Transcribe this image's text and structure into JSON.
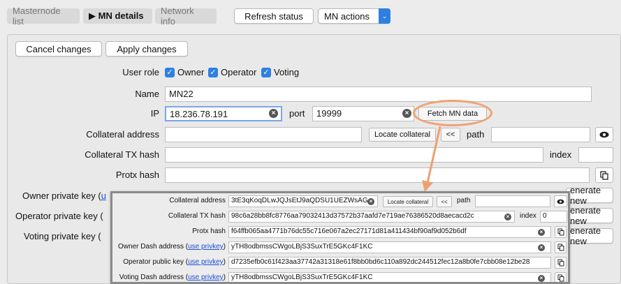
{
  "tabs": {
    "masternode_list": "Masternode list",
    "mn_details": "▶ MN details",
    "network_info": "Network info"
  },
  "toolbar": {
    "refresh_label": "Refresh status",
    "mn_actions_label": "MN actions"
  },
  "actions": {
    "cancel_label": "Cancel changes",
    "apply_label": "Apply changes"
  },
  "form": {
    "user_role_label": "User role",
    "roles": {
      "owner": "Owner",
      "operator": "Operator",
      "voting": "Voting"
    },
    "name_label": "Name",
    "name_value": "MN22",
    "ip_label": "IP",
    "ip_value": "18.236.78.191",
    "port_label": "port",
    "port_value": "19999",
    "fetch_label": "Fetch MN data",
    "collateral_address_label": "Collateral address",
    "collateral_address_value": "",
    "locate_collateral_label": "Locate collateral",
    "nav_back_label": "<<",
    "path_label": "path",
    "path_value": "",
    "collateral_tx_label": "Collateral TX hash",
    "collateral_tx_value": "",
    "index_label": "index",
    "index_value": "",
    "protx_label": "Protx hash",
    "protx_value": "",
    "owner_key_label": "Owner private key (",
    "owner_key_link": "u",
    "operator_key_label": "Operator private key (",
    "voting_key_label": "Voting private key (",
    "generate_new_label": "enerate new"
  },
  "zoom": {
    "collateral_address_label": "Collateral address",
    "collateral_address_value": "3tE3qKoqDLwJQJsEtJ9aQDSU1UEZWsAG",
    "locate_collateral_label": "Locate collateral",
    "nav_back_label": "<<",
    "path_label": "path",
    "path_value": "",
    "collateral_tx_label": "Collateral TX hash",
    "collateral_tx_value": "98c6a28bb8fc8776aa79032413d37572b37aafd7e719ae76386520d8aecacd2c",
    "index_label": "index",
    "index_value": "0",
    "protx_label": "Protx hash",
    "protx_value": "f64ffb065aa4771b76dc55c716e067a2ec27171d81a411434bf90af9d052b6df",
    "owner_dash_label": "Owner Dash address (",
    "operator_pub_label": "Operator public key (",
    "voting_dash_label": "Voting Dash address (",
    "use_privkey_link": "use privkey",
    "close_paren": ")",
    "owner_dash_value": "yTH8odbmssCWgoLBjS3SuxTrE5GKc4F1KC",
    "operator_pub_value": "d7235efb0c61f423aa37742a31318e61f8bb0bd6c110a892dc244512fec12a8b0fe7cbb08e12be28",
    "voting_dash_value": "yTH8odbmssCWgoLBjS3SuxTrE5GKc4F1KC"
  },
  "colors": {
    "accent": "#2f7fe0",
    "highlight_ring": "#f0a070",
    "link": "#1a4fd6"
  }
}
